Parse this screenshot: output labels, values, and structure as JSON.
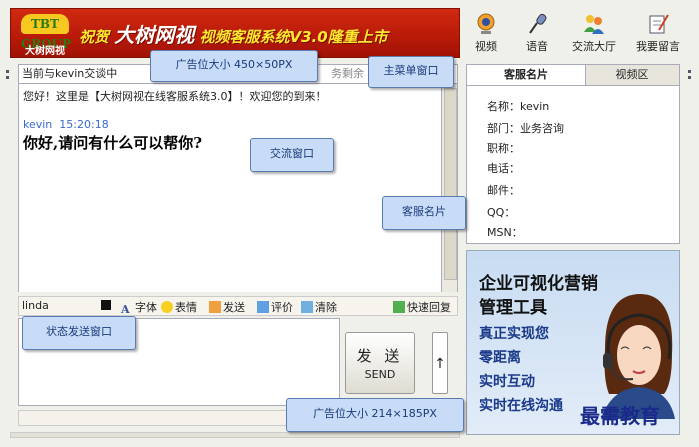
{
  "banner": {
    "logo_top": "TBT GROUP",
    "logo_bottom": "大树网视",
    "prefix": "祝贺",
    "brand": "大树网视",
    "suffix": "视频客服系统V3.0隆重上市"
  },
  "menu": {
    "items": [
      {
        "label": "视频",
        "icon": "webcam-icon"
      },
      {
        "label": "语音",
        "icon": "microphone-icon"
      },
      {
        "label": "交流大厅",
        "icon": "users-icon"
      },
      {
        "label": "我要留言",
        "icon": "note-icon"
      }
    ]
  },
  "chat": {
    "header": "当前与kevin交谈中",
    "header_fragment": "务剩余",
    "welcome": "您好！这里是【大树网视在线客服系统3.0】！欢迎您的到来！",
    "sender": "kevin",
    "time": "15:20:18",
    "message": "你好,请问有什么可以帮你?"
  },
  "toolbar": {
    "nickname": "linda",
    "font": "字体",
    "emoji": "表情",
    "send": "发送",
    "rate": "评价",
    "clear": "清除",
    "quick_reply": "快速回复"
  },
  "send_button": {
    "cn": "发 送",
    "en": "SEND",
    "arrow": "↑"
  },
  "tabs": {
    "card": "客服名片",
    "video": "视频区"
  },
  "card": {
    "fields": [
      {
        "label": "名称：",
        "value": "kevin"
      },
      {
        "label": "部门：",
        "value": "业务咨询"
      },
      {
        "label": "职称：",
        "value": ""
      },
      {
        "label": "电话：",
        "value": ""
      },
      {
        "label": "邮件：",
        "value": ""
      },
      {
        "label": "QQ：",
        "value": ""
      },
      {
        "label": "MSN：",
        "value": ""
      }
    ]
  },
  "ad": {
    "lines": [
      "企业可视化营销",
      "管理工具",
      "真正实现您",
      "零距离",
      "实时互动",
      "实时在线沟通"
    ]
  },
  "callouts": {
    "banner_ad": "广告位大小  450×50PX",
    "main_menu": "主菜单窗口",
    "chat_window": "交流窗口",
    "agent_card": "客服名片",
    "status_send": "状态发送窗口",
    "side_ad": "广告位大小  214×185PX"
  },
  "watermark": "最需教育",
  "colors": {
    "banner_red": "#c8200c",
    "callout_bg": "#c8dcf8",
    "link_blue": "#3a6ad0"
  }
}
